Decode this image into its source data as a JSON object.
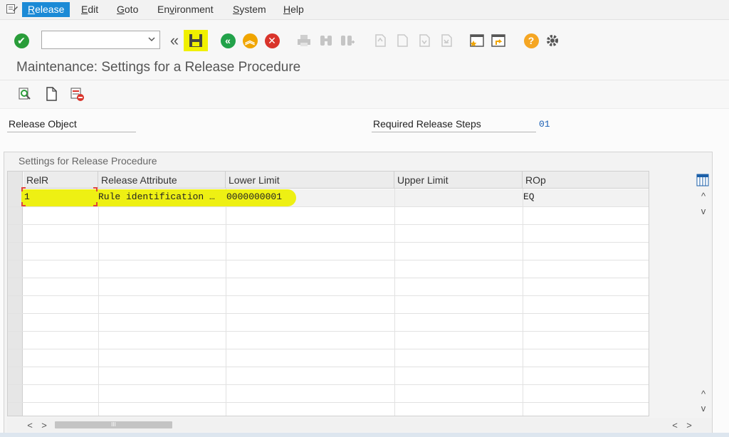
{
  "menu": {
    "items": [
      "Release",
      "Edit",
      "Goto",
      "Environment",
      "System",
      "Help"
    ],
    "underlined": [
      "R",
      "E",
      "G",
      "v",
      "S",
      "H"
    ],
    "active_index": 0
  },
  "toolbar": {
    "command_field": {
      "value": "",
      "placeholder": ""
    },
    "icons": [
      "enter-icon",
      "back-double-icon",
      "save-icon",
      "back-icon",
      "exit-icon",
      "cancel-icon",
      "print-icon",
      "find-icon",
      "find-next-icon",
      "first-page-icon",
      "previous-page-icon",
      "next-page-icon",
      "last-page-icon",
      "new-session-icon",
      "shortcut-icon",
      "help-icon",
      "settings-gear-icon"
    ]
  },
  "page": {
    "title": "Maintenance: Settings for a Release Procedure",
    "app_toolbar_icons": [
      "display-icon",
      "new-entries-icon",
      "delete-icon"
    ]
  },
  "fields": {
    "release_object_label": "Release Object",
    "required_steps_label": "Required Release Steps",
    "required_steps_value": "01"
  },
  "table": {
    "caption": "Settings for Release Procedure",
    "columns": [
      "RelR",
      "Release Attribute",
      "Lower Limit",
      "Upper Limit",
      "ROp"
    ],
    "rows": [
      [
        "1",
        "Rule identification …",
        "0000000001",
        "",
        "EQ"
      ]
    ],
    "visible_row_count": 13
  },
  "scroll": {
    "up": "^",
    "down": "v",
    "left": "<",
    "right": ">",
    "thumb_label": "III"
  },
  "colors": {
    "active_menu": "#1b8ad6",
    "enter_green": "#2a9d3a",
    "nav_green": "#22a24a",
    "exit_orange": "#f0a500",
    "cancel_red": "#d9342b",
    "highlight_yellow": "#eef000",
    "value_blue": "#1a5fb4",
    "help_orange": "#f5a623"
  }
}
